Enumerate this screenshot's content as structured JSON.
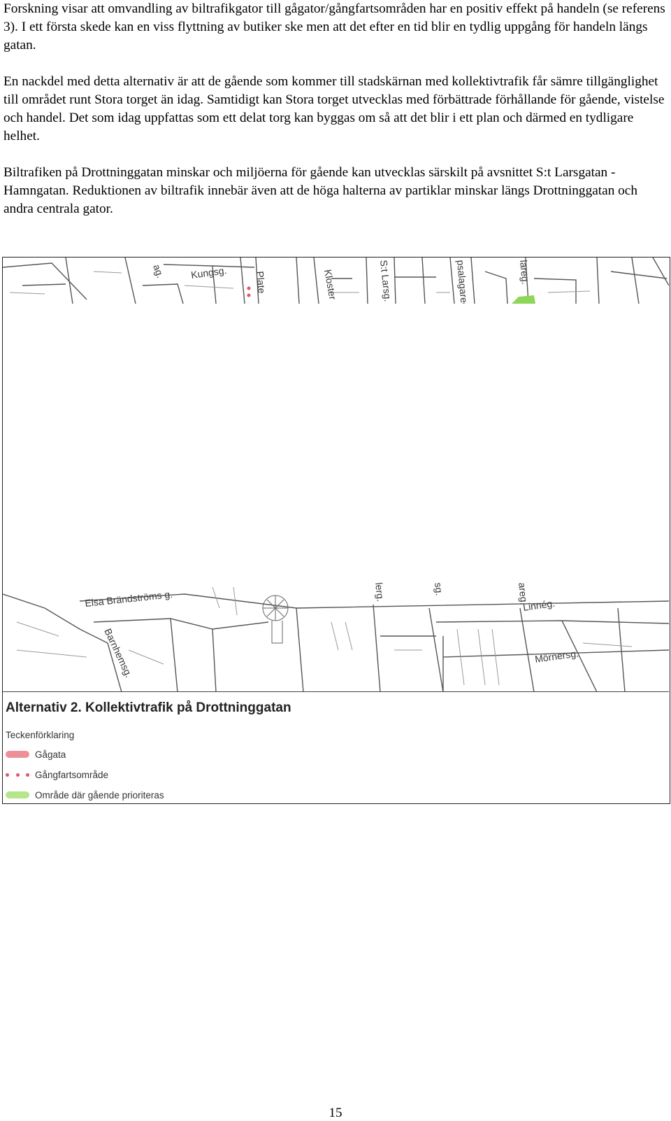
{
  "paragraphs": [
    "Forskning visar att omvandling av biltrafikgator till gågator/gångfartsområden har en positiv effekt på handeln (se referens 3). I ett första skede kan en viss flyttning av butiker ske men att det efter en tid blir en tydlig uppgång för handeln längs gatan.",
    "En nackdel med detta alternativ är att de gående som kommer till stadskärnan med kollektivtrafik får sämre tillgänglighet till området runt Stora torget än idag. Samtidigt kan Stora torget utvecklas med förbättrade förhållande för gående, vistelse och handel. Det som idag uppfattas som ett delat torg kan byggas om så att det blir i ett plan och därmed en tydligare helhet.",
    "Biltrafiken på Drottninggatan minskar och miljöerna för gående kan utvecklas särskilt på avsnittet S:t Larsgatan - Hamngatan. Reduktionen av biltrafik innebär även att de höga halterna av partiklar minskar längs Drottninggatan och andra centrala gator."
  ],
  "map": {
    "top_labels": [
      "ag.",
      "Kungsg.",
      "Plate",
      "Kloster",
      "S:t Larsg.",
      "psalagareg.",
      "lareg."
    ],
    "bottom_labels": [
      "Elsa Brändströms g.",
      "Barnhemsg.",
      "lerg.",
      "sg.",
      "areg.",
      "Linnég.",
      "Mörnersg."
    ],
    "colors": {
      "gagata": "#ef8f9a",
      "gangfart": "#e0556a",
      "prioriterat": "#b4e68a",
      "street": "#555555"
    }
  },
  "legend": {
    "title": "Alternativ 2. Kollektivtrafik på Drottninggatan",
    "heading": "Teckenförklaring",
    "items": [
      {
        "label": "Gågata",
        "icon": "pink-bar-swatch"
      },
      {
        "label": "Gångfartsområde",
        "icon": "dotted-line-swatch"
      },
      {
        "label": "Område där gående prioriteras",
        "icon": "green-bar-swatch"
      }
    ]
  },
  "page_number": "15"
}
